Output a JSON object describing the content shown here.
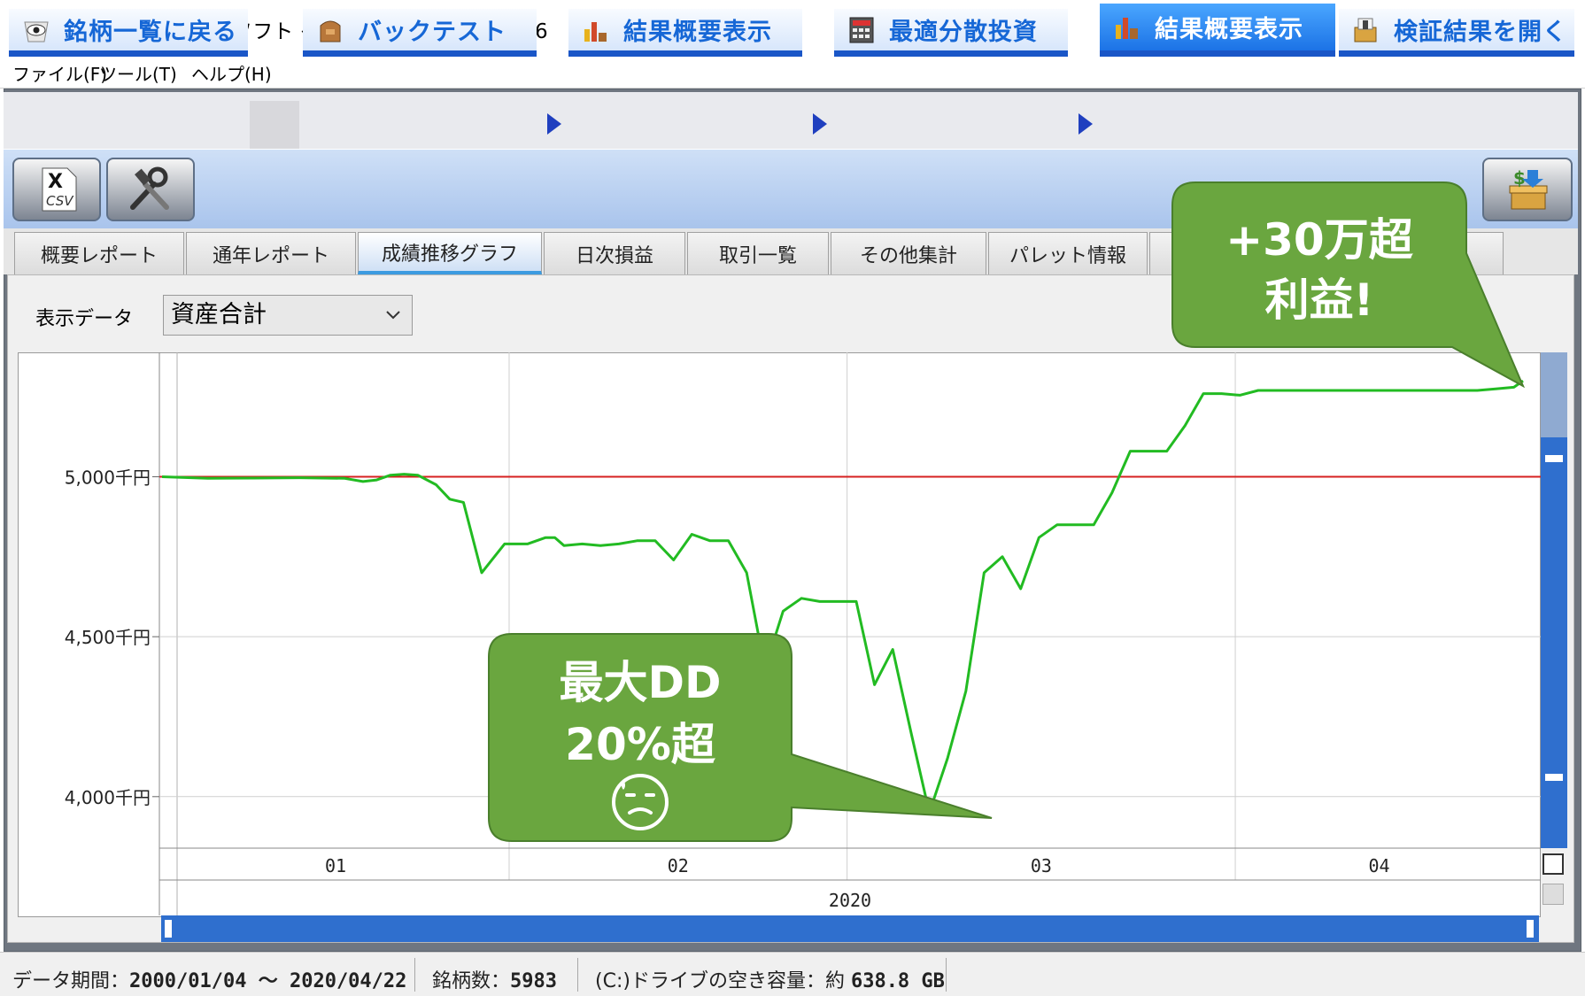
{
  "window": {
    "title": "株システムトレードソフト イザナミ - Version 2.2.16",
    "minimize_icon": "minimize-icon",
    "maximize_icon": "maximize-icon",
    "close_icon": "close-icon"
  },
  "menu": {
    "items": [
      "ファイル(F)",
      "ツール(T)",
      "ヘルプ(H)"
    ]
  },
  "workflow_tabs": [
    {
      "label": "銘柄一覧に戻る",
      "icon": "eye-icon"
    },
    {
      "label": "バックテスト",
      "icon": "bag-icon"
    },
    {
      "label": "結果概要表示",
      "icon": "bar-chart-icon"
    },
    {
      "label": "最適分散投資",
      "icon": "calculator-icon"
    },
    {
      "label": "結果概要表示",
      "icon": "bar-chart-icon",
      "active": true
    },
    {
      "label": "検証結果を開く",
      "icon": "open-results-icon"
    }
  ],
  "toolbar": {
    "csv_icon": "csv-export-icon",
    "tools_icon": "tools-icon",
    "money_icon": "money-chest-icon",
    "csv_text": "CSV"
  },
  "report_tabs": [
    "概要レポート",
    "通年レポート",
    "成績推移グラフ",
    "日次損益",
    "取引一覧",
    "その他集計",
    "パレット情報"
  ],
  "report_tabs_active": 2,
  "display": {
    "label": "表示データ",
    "selected": "資産合計"
  },
  "chart_data": {
    "type": "line",
    "y_axis_labels": [
      "5,000千円",
      "4,500千円",
      "4,000千円"
    ],
    "y_ticks": [
      5000,
      4500,
      4000
    ],
    "ylim": [
      3850,
      5400
    ],
    "x_month_labels": [
      "01",
      "02",
      "03",
      "04"
    ],
    "x_year_label": "2020",
    "reference_line": {
      "value": 5000,
      "color": "#d62020"
    },
    "series": [
      {
        "color": "#22bb22",
        "x": [
          0,
          10,
          20,
          30,
          40,
          44,
          47,
          50,
          53,
          56,
          60,
          63,
          66,
          70,
          75,
          80,
          84,
          86,
          88,
          92,
          96,
          100,
          104,
          108,
          112,
          116,
          120,
          124,
          128,
          132,
          136,
          140,
          144,
          148,
          152,
          156,
          160,
          164,
          168,
          172,
          176,
          180,
          184,
          188,
          192,
          196,
          200,
          204,
          208,
          212,
          216,
          220,
          224,
          228,
          232,
          236,
          240,
          244,
          248,
          252,
          256,
          260,
          264,
          268,
          272,
          276,
          280,
          284,
          288,
          292,
          296,
          298
        ],
        "values": [
          5000,
          4995,
          4996,
          4997,
          4995,
          4985,
          4990,
          5005,
          5008,
          5005,
          4975,
          4930,
          4920,
          4700,
          4790,
          4790,
          4810,
          4810,
          4785,
          4790,
          4785,
          4790,
          4800,
          4800,
          4740,
          4820,
          4800,
          4800,
          4700,
          4400,
          4580,
          4620,
          4610,
          4610,
          4610,
          4350,
          4460,
          4200,
          3950,
          4120,
          4330,
          4700,
          4750,
          4650,
          4810,
          4850,
          4850,
          4850,
          4950,
          5080,
          5080,
          5080,
          5160,
          5260,
          5260,
          5255,
          5270,
          5270,
          5270,
          5270,
          5270,
          5270,
          5270,
          5270,
          5270,
          5270,
          5270,
          5270,
          5270,
          5275,
          5280,
          5300
        ],
        "x_range": [
          0,
          298
        ],
        "month_boundaries": [
          0,
          76,
          150,
          235,
          298
        ]
      }
    ]
  },
  "callouts": {
    "profit_line1": "+30万超",
    "profit_line2": "利益!",
    "dd_line1": "最大DD",
    "dd_line2": "20%超",
    "callout_color": "#6aa63f",
    "dd_emoji": "sweat-face-icon"
  },
  "status": {
    "period_label": "データ期間：",
    "period_value": "2000/01/04 〜 2020/04/22",
    "count_label": "銘柄数：",
    "count_value": "5983",
    "drive_label": "(C:)ドライブの空き容量：約",
    "drive_value": "638.8 GB"
  }
}
